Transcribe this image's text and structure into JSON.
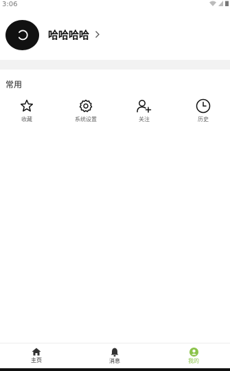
{
  "status_bar": {
    "time": "3:06"
  },
  "profile": {
    "username": "哈哈哈哈"
  },
  "section": {
    "title": "常用"
  },
  "shortcuts": [
    {
      "label": "收藏",
      "icon": "star-icon"
    },
    {
      "label": "系统设置",
      "icon": "gear-icon"
    },
    {
      "label": "关注",
      "icon": "add-user-icon"
    },
    {
      "label": "历史",
      "icon": "clock-icon"
    }
  ],
  "tabbar": {
    "items": [
      {
        "label": "主页",
        "icon": "home-icon"
      },
      {
        "label": "消息",
        "icon": "bell-icon"
      },
      {
        "label": "我的",
        "icon": "user-circle-icon"
      }
    ],
    "active_index": 2
  },
  "colors": {
    "accent": "#8bc34a",
    "band": "#f2f2f2",
    "avatar": "#111111"
  }
}
